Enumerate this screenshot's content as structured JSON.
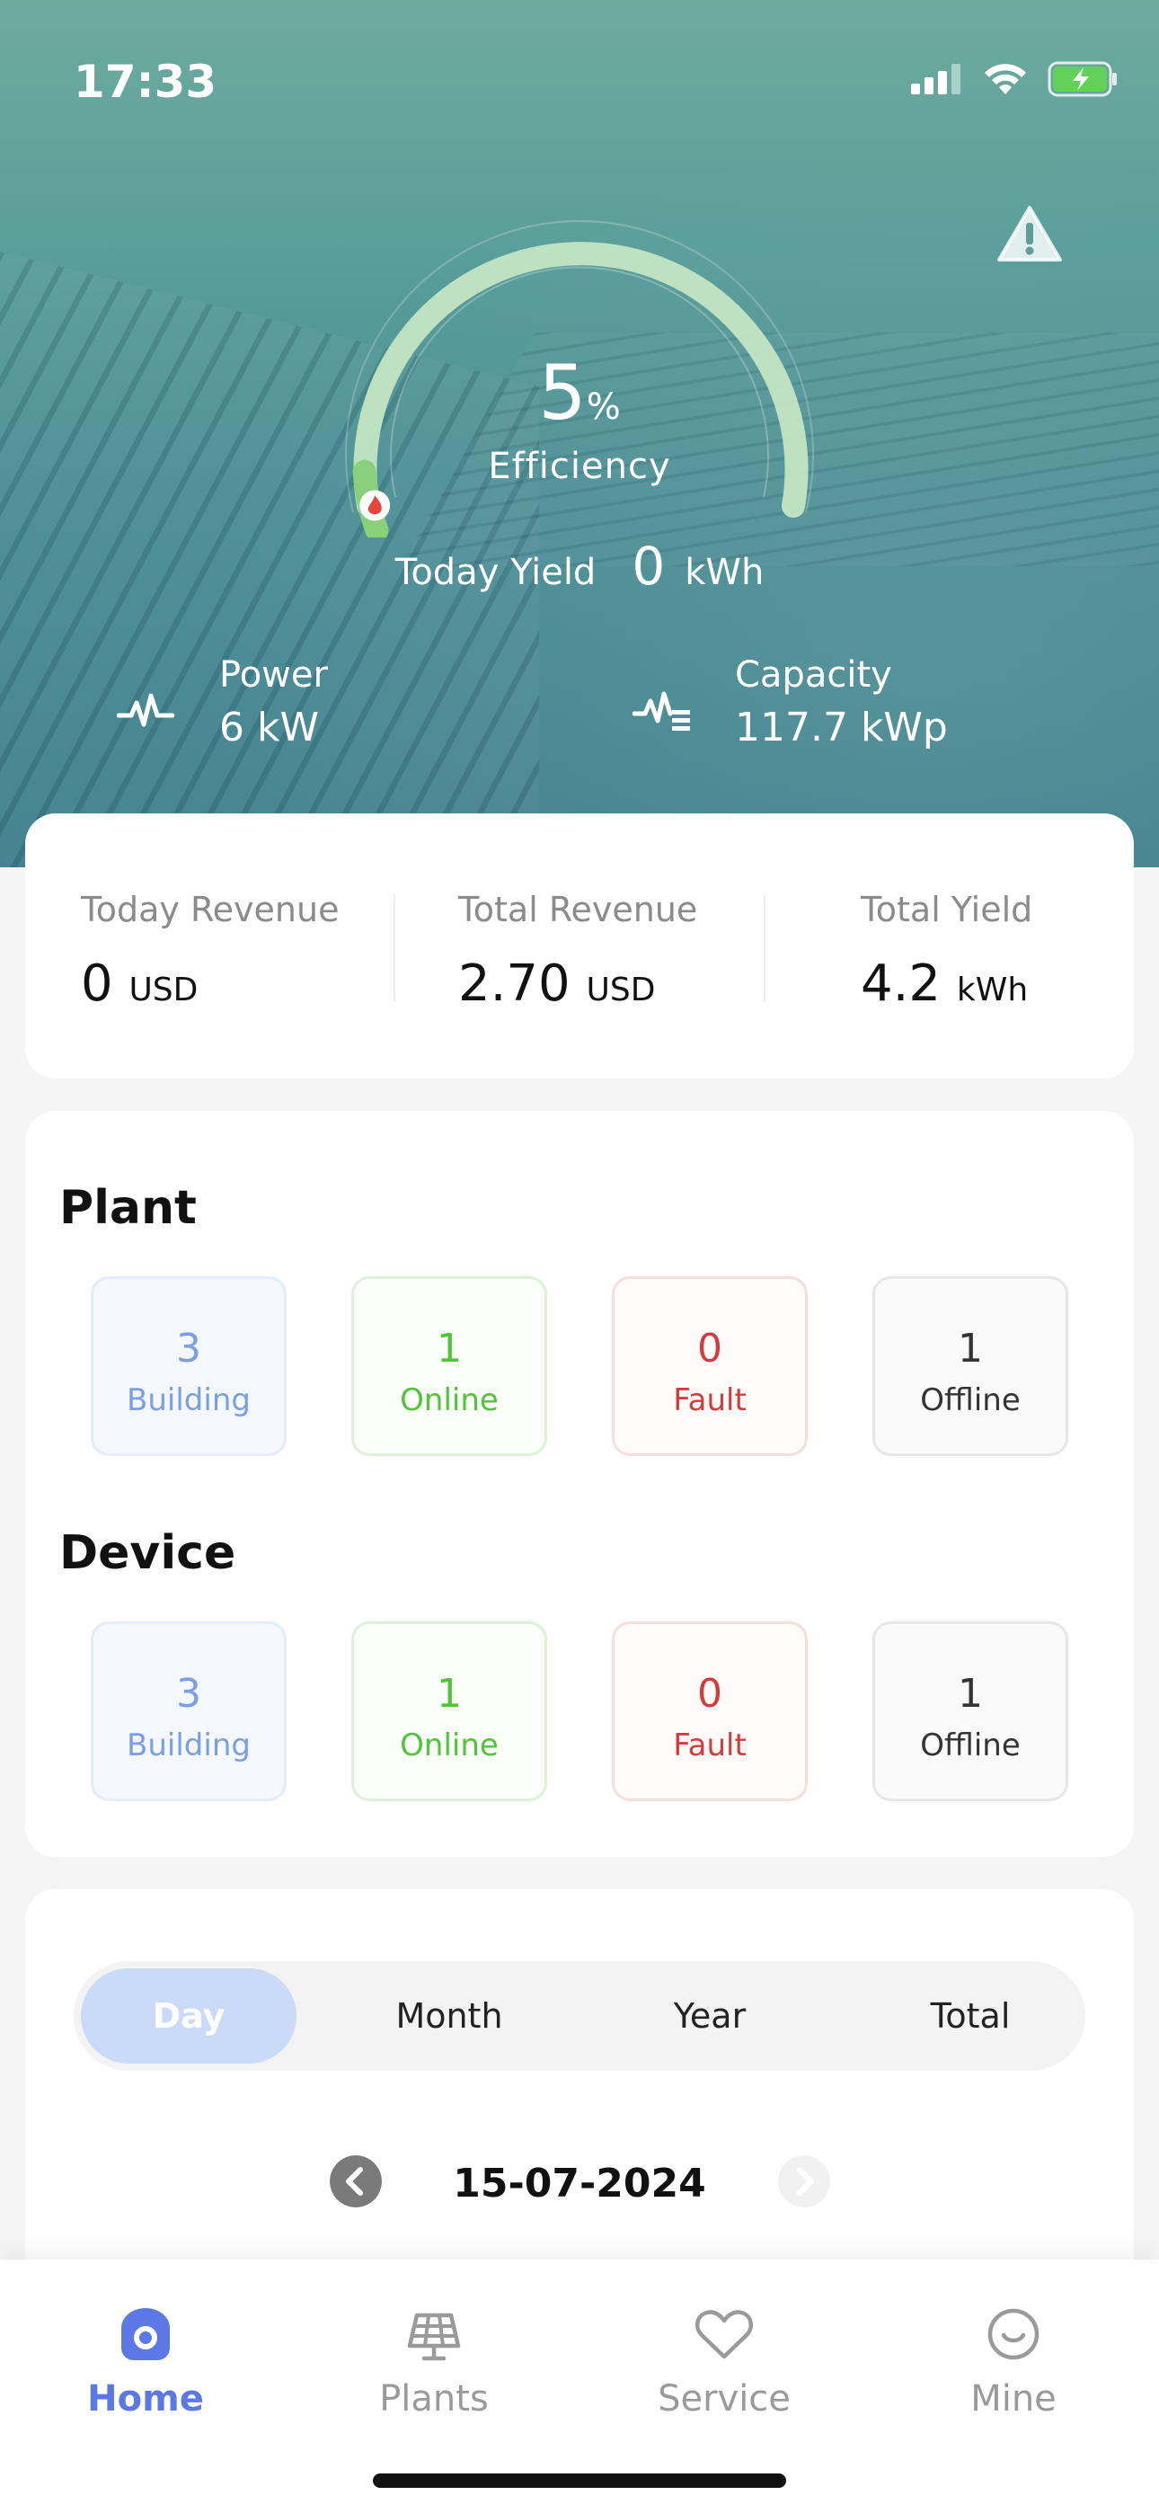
{
  "status_bar": {
    "time": "17:33"
  },
  "hero": {
    "efficiency_value": "5",
    "efficiency_unit": "%",
    "efficiency_level": 0.05,
    "efficiency_label": "Efficiency",
    "today_yield_label": "Today Yield",
    "today_yield_value": "0",
    "today_yield_unit": "kWh",
    "power_label": "Power",
    "power_value": "6 kW",
    "capacity_label": "Capacity",
    "capacity_value": "117.7 kWp"
  },
  "revenue": {
    "today_label": "Today Revenue",
    "today_value": "0",
    "today_unit": "USD",
    "total_label": "Total Revenue",
    "total_value": "2.70",
    "total_unit": "USD",
    "yield_label": "Total Yield",
    "yield_value": "4.2",
    "yield_unit": "kWh"
  },
  "plant": {
    "title": "Plant",
    "tiles": [
      {
        "count": "3",
        "label": "Building"
      },
      {
        "count": "1",
        "label": "Online"
      },
      {
        "count": "0",
        "label": "Fault"
      },
      {
        "count": "1",
        "label": "Offline"
      }
    ]
  },
  "device": {
    "title": "Device",
    "tiles": [
      {
        "count": "3",
        "label": "Building"
      },
      {
        "count": "1",
        "label": "Online"
      },
      {
        "count": "0",
        "label": "Fault"
      },
      {
        "count": "1",
        "label": "Offline"
      }
    ]
  },
  "period": {
    "tabs": [
      "Day",
      "Month",
      "Year",
      "Total"
    ],
    "selected": "Day",
    "date": "15-07-2024"
  },
  "tabbar": {
    "items": [
      {
        "label": "Home",
        "icon": "home-icon"
      },
      {
        "label": "Plants",
        "icon": "solar-panel-icon"
      },
      {
        "label": "Service",
        "icon": "heart-icon"
      },
      {
        "label": "Mine",
        "icon": "smile-icon"
      }
    ],
    "active": "Home"
  },
  "colors": {
    "accent": "#5b78e6",
    "online": "#52c43a",
    "fault": "#d43b3b",
    "building": "#7b9fe6"
  }
}
